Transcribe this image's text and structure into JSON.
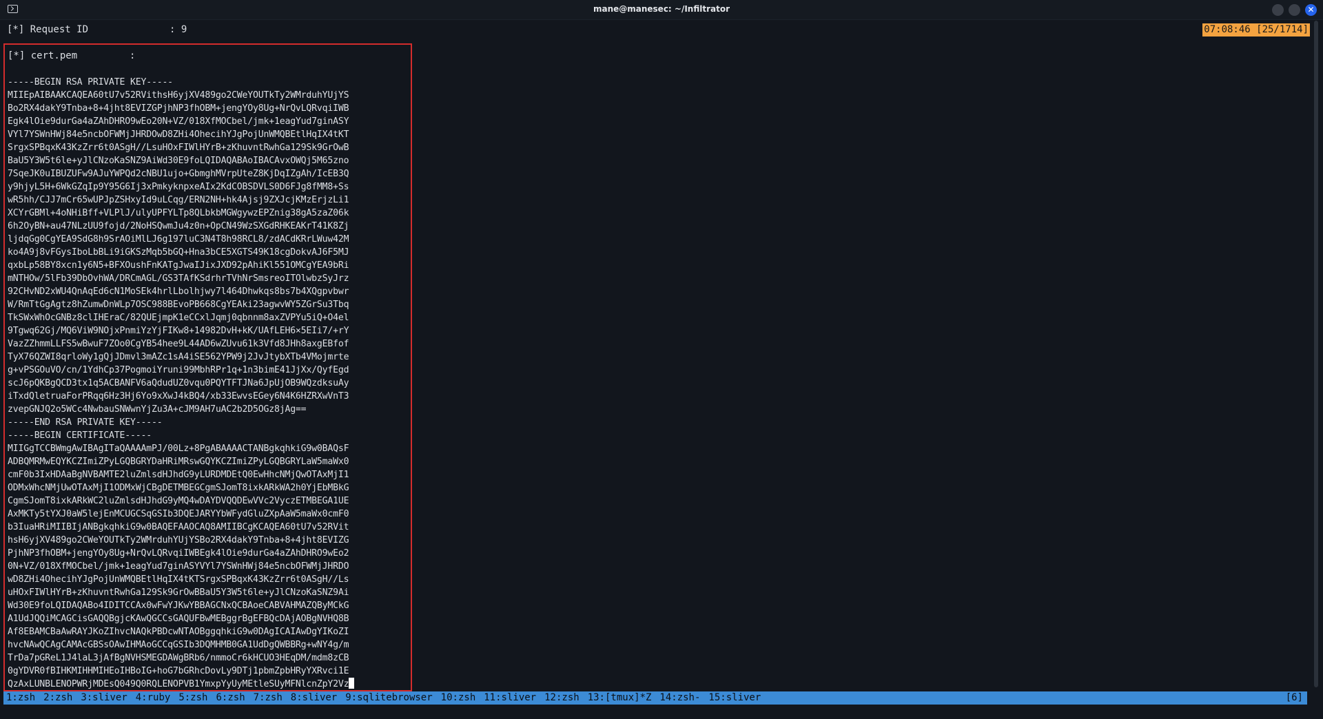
{
  "window": {
    "title": "mane@manesec: ~/Infiltrator",
    "close_glyph": "✕",
    "terminal_icon": "terminal-icon"
  },
  "header_line": "[*] Request ID              : 9",
  "clock": "07:08:46 [25/1714]",
  "pane": {
    "header": "[*] cert.pem         :",
    "lines": [
      "-----BEGIN RSA PRIVATE KEY-----",
      "MIIEpAIBAAKCAQEA60tU7v52RVithsH6yjXV489go2CWeYOUTkTy2WMrduhYUjYS",
      "Bo2RX4dakY9Tnba+8+4jht8EVIZGPjhNP3fhOBM+jengYOy8Ug+NrQvLQRvqiIWB",
      "Egk4lOie9durGa4aZAhDHRO9wEo20N+VZ/018XfMOCbel/jmk+1eagYud7ginASY",
      "VYl7YSWnHWj84e5ncbOFWMjJHRDOwD8ZHi4OhecihYJgPojUnWMQBEtlHqIX4tKT",
      "SrgxSPBqxK43KzZrr6t0ASgH//LsuHOxFIWlHYrB+zKhuvntRwhGa129Sk9GrOwB",
      "BaU5Y3W5t6le+yJlCNzoKaSNZ9AiWd30E9foLQIDAQABAoIBACAvxOWQj5M65zno",
      "7SqeJK0uIBUZUFw9AJuYWPQd2cNBU1ujo+GbmghMVrpUteZ8KjDqIZgAh/IcEB3Q",
      "y9hjyL5H+6WkGZqIp9Y95G6Ij3xPmkyknpxeAIx2KdCOBSDVLS0D6FJg8fMM8+Ss",
      "wR5hh/CJJ7mCr65wUPJpZSHxyId9uLCqg/ERN2NH+hk4Ajsj9ZXJcjKMzErjzLi1",
      "XCYrGBMl+4oNHiBff+VLPlJ/ulyUPFYLTp8QLbkbMGWgywzEPZnig38gA5zaZ06k",
      "6h2OyBN+au47NLzUU9fojd/2NoHSQwmJu4z0n+OpCN49WzSXGdRHKEAKrT41K8Zj",
      "ljdqGg0CgYEA9SdG8h9SrAOiMlLJ6g197luC3N4T8h98RCL8/zdACdKRrLWuw42M",
      "ko4A9j8vFGysIboLbBLi9iGKSzMqb5bGQ+Hna3bCE5XGTS49K18cgDokvAJ6F5MJ",
      "qxbLp58BY8xcn1y6N5+BFXOushFnKATgJwaIJixJXD92pAhiKl551OMCgYEA9bRi",
      "mNTHOw/5lFb39DbOvhWA/DRCmAGL/GS3TAfKSdrhrTVhNrSmsreoITOlwbzSyJrz",
      "92CHvND2xWU4QnAqEd6cN1MoSEk4hrlLbolhjwy7l464Dhwkqs8bs7b4XQgpvbwr",
      "W/RmTtGgAgtz8hZumwDnWLp7OSC988BEvoPB668CgYEAki23agwvWY5ZGrSu3Tbq",
      "TkSWxWhOcGNBz8clIHEraC/82QUEjmpK1eCCxlJqmj0qbnnm8axZVPYu5iQ+O4el",
      "9Tgwq62Gj/MQ6ViW9NOjxPnmiYzYjFIKw8+14982DvH+kK/UAfLEH6×5EIi7/+rY",
      "VazZZhmmLLFS5wBwuF7ZOo0CgYB54hee9L44AD6wZUvu61k3Vfd8JHh8axgEBfof",
      "TyX76QZWI8qrloWy1gQjJDmvl3mAZc1sA4iSE562YPW9j2JvJtybXTb4VMojmrte",
      "g+vPSGOuVO/cn/1YdhCp37PogmoiYruni99MbhRPr1q+1n3bimE41JjXx/QyfEgd",
      "scJ6pQKBgQCD3tx1q5ACBANFV6aQdudUZ0vqu0PQYTFTJNa6JpUjOB9WQzdksuAy",
      "iTxdQletruaForPRqq6Hz3Hj6Yo9xXwJ4kBQ4/xb33EwvsEGey6N4K6HZRXwVnT3",
      "zvepGNJQ2o5WCc4NwbauSNWwnYjZu3A+cJM9AH7uAC2b2D5OGz8jAg==",
      "-----END RSA PRIVATE KEY-----",
      "-----BEGIN CERTIFICATE-----",
      "MIIGgTCCBWmgAwIBAgITaQAAAAmPJ/00Lz+8PgABAAAACTANBgkqhkiG9w0BAQsF",
      "ADBQMRMwEQYKCZImiZPyLGQBGRYDaHRiMRswGQYKCZImiZPyLGQBGRYLaW5maWx0",
      "cmF0b3IxHDAaBgNVBAMTE2luZmlsdHJhdG9yLURDMDEtQ0EwHhcNMjQwOTAxMjI1",
      "ODMxWhcNMjUwOTAxMjI1ODMxWjCBgDETMBEGCgmSJomT8ixkARkWA2h0YjEbMBkG",
      "CgmSJomT8ixkARkWC2luZmlsdHJhdG9yMQ4wDAYDVQQDEwVVc2VyczETMBEGA1UE",
      "AxMKTy5tYXJ0aW5lejEnMCUGCSqGSIb3DQEJARYYbWFydGluZXpAaW5maWx0cmF0",
      "b3IuaHRiMIIBIjANBgkqhkiG9w0BAQEFAAOCAQ8AMIIBCgKCAQEA60tU7v52RVit",
      "hsH6yjXV489go2CWeYOUTkTy2WMrduhYUjYSBo2RX4dakY9Tnba+8+4jht8EVIZG",
      "PjhNP3fhOBM+jengYOy8Ug+NrQvLQRvqiIWBEgk4lOie9durGa4aZAhDHRO9wEo2",
      "0N+VZ/018XfMOCbel/jmk+1eagYud7ginASYVYl7YSWnHWj84e5ncbOFWMjJHRDO",
      "wD8ZHi4OhecihYJgPojUnWMQBEtlHqIX4tKTSrgxSPBqxK43KzZrr6t0ASgH//Ls",
      "uHOxFIWlHYrB+zKhuvntRwhGa129Sk9GrOwBBaU5Y3W5t6le+yJlCNzoKaSNZ9Ai",
      "Wd30E9foLQIDAQABo4IDITCCAx0wFwYJKwYBBAGCNxQCBAoeCABVAHMAZQByMCkG",
      "A1UdJQQiMCAGCisGAQQBgjcKAwQGCCsGAQUFBwMEBggrBgEFBQcDAjAOBgNVHQ8B",
      "Af8EBAMCBaAwRAYJKoZIhvcNAQkPBDcwNTAOBggqhkiG9w0DAgICAIAwDgYIKoZI",
      "hvcNAwQCAgCAMAcGBSsOAwIHMAoGCCqGSIb3DQMHMB0GA1UdDgQWBBRg+wNY4g/m",
      "TrDa7pGReL1J4laL3jAfBgNVHSMEGDAWgBRb6/nmmoCr6kHCUO3HEqDM/mdm8zCB",
      "0gYDVR0fBIHKMIHHMIHEoIHBoIG+hoG7bGRhcDovLy9DTj1pbmZpbHRyYXRvci1E",
      "QzAxLUNBLENOPWRjMDEsQ049Q0RQLENOPVB1YmxpYyUyMEtleSUyMFNlcnZpY2Vz"
    ]
  },
  "statusbar": {
    "windows": [
      "1:zsh",
      "2:zsh",
      "3:sliver",
      "4:ruby",
      "5:zsh",
      "6:zsh",
      "7:zsh",
      "8:sliver",
      "9:sqlitebrowser",
      "10:zsh",
      "11:sliver",
      "12:zsh",
      "13:[tmux]*Z",
      "14:zsh-",
      "15:sliver"
    ],
    "right": "[6]"
  }
}
